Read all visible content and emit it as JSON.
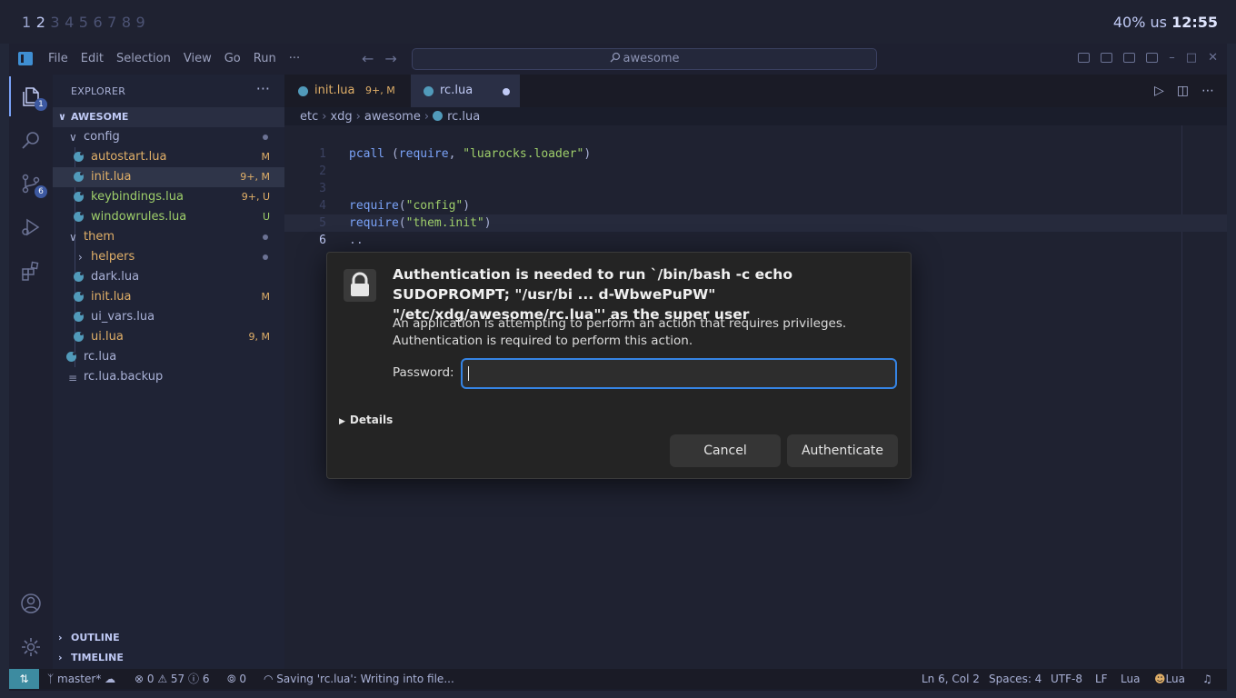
{
  "wm": {
    "workspaces": [
      "1",
      "2",
      "3",
      "4",
      "5",
      "6",
      "7",
      "8",
      "9"
    ],
    "status": "40% us",
    "clock": "12:55"
  },
  "titlebar": {
    "menu": [
      "File",
      "Edit",
      "Selection",
      "View",
      "Go",
      "Run",
      "···"
    ],
    "search": "awesome"
  },
  "activity": {
    "explorer_badge": "1",
    "scm_badge": "6"
  },
  "sidebar": {
    "title": "EXPLORER",
    "more": "···",
    "root": "AWESOME",
    "items": [
      {
        "name": "config",
        "status": ""
      },
      {
        "name": "autostart.lua",
        "status": "M"
      },
      {
        "name": "init.lua",
        "status": "9+, M"
      },
      {
        "name": "keybindings.lua",
        "status": "9+, U"
      },
      {
        "name": "windowrules.lua",
        "status": "U"
      },
      {
        "name": "them",
        "status": ""
      },
      {
        "name": "helpers",
        "status": ""
      },
      {
        "name": "dark.lua",
        "status": ""
      },
      {
        "name": "init.lua",
        "status": "M"
      },
      {
        "name": "ui_vars.lua",
        "status": ""
      },
      {
        "name": "ui.lua",
        "status": "9, M"
      },
      {
        "name": "rc.lua",
        "status": ""
      },
      {
        "name": "rc.lua.backup",
        "status": ""
      }
    ],
    "outline": "OUTLINE",
    "timeline": "TIMELINE"
  },
  "tabs": [
    {
      "label": "init.lua",
      "status": "9+, M"
    },
    {
      "label": "rc.lua"
    }
  ],
  "breadcrumb": [
    "etc",
    "xdg",
    "awesome",
    "rc.lua"
  ],
  "code": {
    "line_numbers": [
      "1",
      "2",
      "3",
      "4",
      "5",
      "6"
    ],
    "line1": [
      "pcall",
      " (",
      "require",
      ", ",
      "\"luarocks.loader\"",
      ")"
    ],
    "line4": [
      "require",
      "(",
      "\"config\"",
      ")"
    ],
    "line5": [
      "require",
      "(",
      "\"them.init\"",
      ")"
    ],
    "line6": ".."
  },
  "statusbar": {
    "branch": "master*",
    "errors": "0",
    "warnings": "57",
    "infos": "6",
    "ports": "0",
    "saving": "Saving 'rc.lua': Writing into file...",
    "position": "Ln 6, Col 2",
    "spaces": "Spaces: 4",
    "encoding": "UTF-8",
    "eol": "LF",
    "language": "Lua",
    "lang_mode": "Lua"
  },
  "dialog": {
    "title": "Authentication is needed to run `/bin/bash -c echo SUDOPROMPT; \"/usr/bi ... d-WbwePuPW\" \"/etc/xdg/awesome/rc.lua\"' as the super user",
    "body": "An application is attempting to perform an action that requires privileges. Authentication is required to perform this action.",
    "password_label": "Password:",
    "password_value": "",
    "details": "Details",
    "cancel": "Cancel",
    "authenticate": "Authenticate"
  },
  "colors": {
    "accent": "#3584e4",
    "modified": "#e0af68",
    "untracked": "#9ece6a",
    "lua_icon": "#519aba"
  }
}
